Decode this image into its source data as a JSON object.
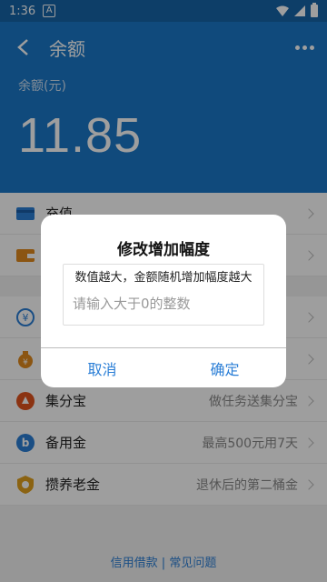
{
  "status": {
    "time": "1:36",
    "notif": "A"
  },
  "header": {
    "title": "余额",
    "balance_label": "余额(元)",
    "balance_value": "11.85"
  },
  "rows_top": [
    {
      "label": "充值",
      "icon": "card-icon"
    },
    {
      "label": "提现",
      "icon": "wallet-icon"
    }
  ],
  "rows_bottom": [
    {
      "label": "",
      "desc": "",
      "icon": "yuan-circle-icon"
    },
    {
      "label": "",
      "desc": "",
      "icon": "money-bag-icon"
    },
    {
      "label": "集分宝",
      "desc": "做任务送集分宝",
      "icon": "jifenbao-icon"
    },
    {
      "label": "备用金",
      "desc": "最高500元用7天",
      "icon": "beiyongjin-icon"
    },
    {
      "label": "攒养老金",
      "desc": "退休后的第二桶金",
      "icon": "shield-icon"
    }
  ],
  "footer": {
    "text": "信用借款 | 常见问题"
  },
  "dialog": {
    "title": "修改增加幅度",
    "hint": "数值越大，金额随机增加幅度越大",
    "placeholder": "请输入大于0的整数",
    "cancel": "取消",
    "confirm": "确定"
  },
  "colors": {
    "header": "#1a78c9",
    "accent": "#2a7ed6"
  }
}
